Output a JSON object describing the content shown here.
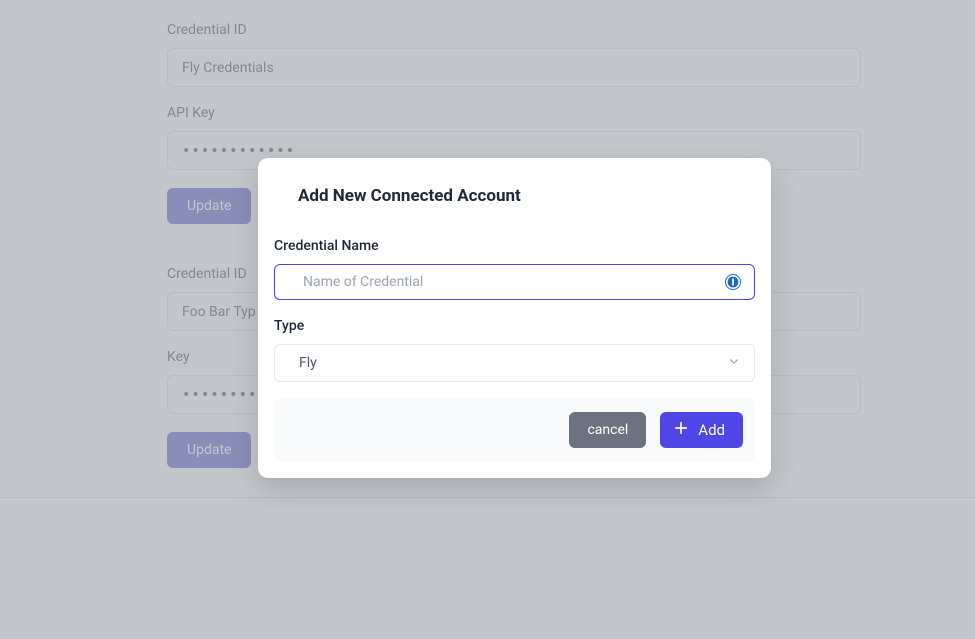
{
  "background": {
    "forms": [
      {
        "id_label": "Credential ID",
        "id_value": "Fly Credentials",
        "key_label": "API Key",
        "key_value": "••••••••••••",
        "button_label": "Update"
      },
      {
        "id_label": "Credential ID",
        "id_value": "Foo Bar Typ",
        "key_label": "Key",
        "key_value": "•••••••••••••••",
        "button_label": "Update"
      }
    ]
  },
  "modal": {
    "title": "Add New Connected Account",
    "name_label": "Credential Name",
    "name_placeholder": "Name of Credential",
    "type_label": "Type",
    "type_value": "Fly",
    "cancel_label": "cancel",
    "add_label": "Add"
  }
}
